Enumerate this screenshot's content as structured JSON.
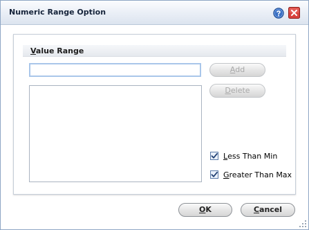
{
  "window": {
    "title": "Numeric Range Option"
  },
  "titlebar_icons": [
    "help-icon",
    "close-icon"
  ],
  "section": {
    "label": "Value Range",
    "access_key": "V"
  },
  "value_input": {
    "value": "",
    "placeholder": ""
  },
  "value_list": {
    "items": []
  },
  "buttons": {
    "add": {
      "label": "Add",
      "enabled": false
    },
    "delete": {
      "label": "Delete",
      "enabled": false
    },
    "ok": {
      "label": "OK"
    },
    "cancel": {
      "label": "Cancel"
    }
  },
  "checkboxes": {
    "less_than_min": {
      "label": "Less Than Min",
      "checked": true
    },
    "greater_than_max": {
      "label": "Greater Than Max",
      "checked": true
    }
  },
  "colors": {
    "title_text": "#15233a",
    "input_focus_border": "#a9c6ea",
    "close_red": "#d8423d",
    "help_blue": "#3a70c4"
  }
}
